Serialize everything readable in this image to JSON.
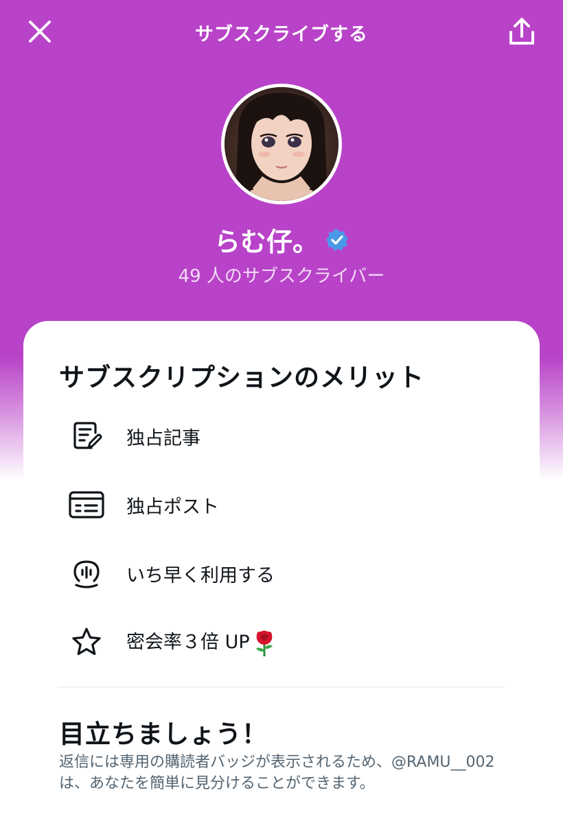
{
  "header": {
    "title": "サブスクライブする",
    "close_icon": "close-icon",
    "share_icon": "share-icon"
  },
  "profile": {
    "name": "らむ仔。",
    "verified": true,
    "subscriber_text": "49 人のサブスクライバー"
  },
  "benefits": {
    "title": "サブスクリプションのメリット",
    "items": [
      {
        "icon": "article-icon",
        "label": "独占記事"
      },
      {
        "icon": "post-icon",
        "label": "独占ポスト"
      },
      {
        "icon": "spaces-icon",
        "label": "いち早く利用する"
      },
      {
        "icon": "star-icon",
        "label": "密会率３倍 UP"
      }
    ]
  },
  "standout": {
    "title": "目立ちましょう！",
    "description": "返信には専用の購読者バッジが表示されるため、@RAMU__002 は、あなたを簡単に見分けることができます。"
  },
  "colors": {
    "header_bg": "#b843c8",
    "verified": "#4a99e9",
    "text_primary": "#0f1419",
    "text_secondary": "#536471"
  }
}
